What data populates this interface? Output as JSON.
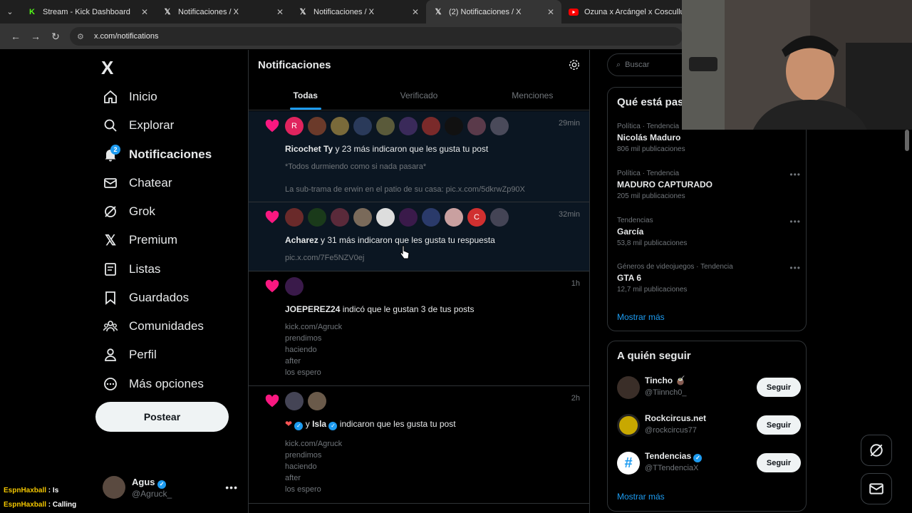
{
  "browser": {
    "tabs": [
      {
        "title": "Stream - Kick Dashboard",
        "icon": "kick-icon",
        "active": false
      },
      {
        "title": "Notificaciones / X",
        "icon": "x-logo-icon",
        "active": false
      },
      {
        "title": "Notificaciones / X",
        "icon": "x-logo-icon",
        "active": false
      },
      {
        "title": "(2) Notificaciones / X",
        "icon": "x-logo-icon",
        "active": true
      },
      {
        "title": "Ozuna x Arcángel x Cosculluela",
        "icon": "youtube-icon",
        "active": false
      }
    ],
    "url": "x.com/notifications"
  },
  "sidebar": {
    "logo": "X",
    "items": [
      {
        "label": "Inicio",
        "icon": "home-icon"
      },
      {
        "label": "Explorar",
        "icon": "search-icon"
      },
      {
        "label": "Notificaciones",
        "icon": "bell-icon",
        "badge": "2"
      },
      {
        "label": "Chatear",
        "icon": "mail-icon"
      },
      {
        "label": "Grok",
        "icon": "grok-icon"
      },
      {
        "label": "Premium",
        "icon": "x-premium-icon"
      },
      {
        "label": "Listas",
        "icon": "list-icon"
      },
      {
        "label": "Guardados",
        "icon": "bookmark-icon"
      },
      {
        "label": "Comunidades",
        "icon": "communities-icon"
      },
      {
        "label": "Perfil",
        "icon": "person-icon"
      },
      {
        "label": "Más opciones",
        "icon": "more-circle-icon"
      }
    ],
    "post_label": "Postear",
    "account": {
      "name": "Agus",
      "handle": "@Agruck_"
    }
  },
  "main": {
    "title": "Notificaciones",
    "tabs": [
      "Todas",
      "Verificado",
      "Menciones"
    ],
    "notifications": [
      {
        "time": "29min",
        "user": "Ricochet Ty",
        "text": " y 23 más indicaron que les gusta tu post",
        "lines": [
          "*Todos durmiendo como si nada pasara*",
          "",
          "La sub-trama de erwin en el patio de su casa: pic.x.com/5dkrwZp90X"
        ]
      },
      {
        "time": "32min",
        "user": "Acharez",
        "text": " y 31 más indicaron que les gusta tu respuesta",
        "lines": [
          "pic.x.com/7Fe5NZV0ej"
        ]
      },
      {
        "time": "1h",
        "user": "JOEPEREZ24",
        "text": " indicó que le gustan 3 de tus posts",
        "lines": [
          "kick.com/Agruck",
          "prendimos",
          "haciendo",
          "after",
          "los espero"
        ]
      },
      {
        "time": "2h",
        "user": "Isla",
        "prefix": "y ",
        "text": " indicaron que les gusta tu post",
        "lines": [
          "kick.com/Agruck",
          "prendimos",
          "haciendo",
          "after",
          "los espero"
        ]
      }
    ]
  },
  "right": {
    "search_placeholder": "Buscar",
    "trends_title": "Qué está pasando",
    "trends": [
      {
        "category": "Política · Tendencia",
        "name": "Nicolás Maduro",
        "count": "806 mil publicaciones"
      },
      {
        "category": "Política · Tendencia",
        "name": "MADURO CAPTURADO",
        "count": "205 mil publicaciones"
      },
      {
        "category": "Tendencias",
        "name": "García",
        "count": "53,8 mil publicaciones"
      },
      {
        "category": "Géneros de videojuegos · Tendencia",
        "name": "GTA 6",
        "count": "12,7 mil publicaciones"
      }
    ],
    "show_more": "Mostrar más",
    "follow_title": "A quién seguir",
    "follow": [
      {
        "name": "Tincho 🧉",
        "handle": "@Tiinnch0_",
        "button": "Seguir"
      },
      {
        "name": "Rockcircus.net",
        "handle": "@rockcircus77",
        "button": "Seguir"
      },
      {
        "name": "Tendencias",
        "handle": "@TTendenciaX",
        "button": "Seguir",
        "verified": true
      }
    ],
    "follow_more": "Mostrar más"
  },
  "chat": [
    {
      "user": "EspnHaxball",
      "msg": " : Is"
    },
    {
      "user": "EspnHaxball",
      "msg": " : Calling"
    }
  ],
  "colors": {
    "accent": "#1d9bf0",
    "like": "#f91880",
    "background": "#000000",
    "border": "#2f3336"
  }
}
